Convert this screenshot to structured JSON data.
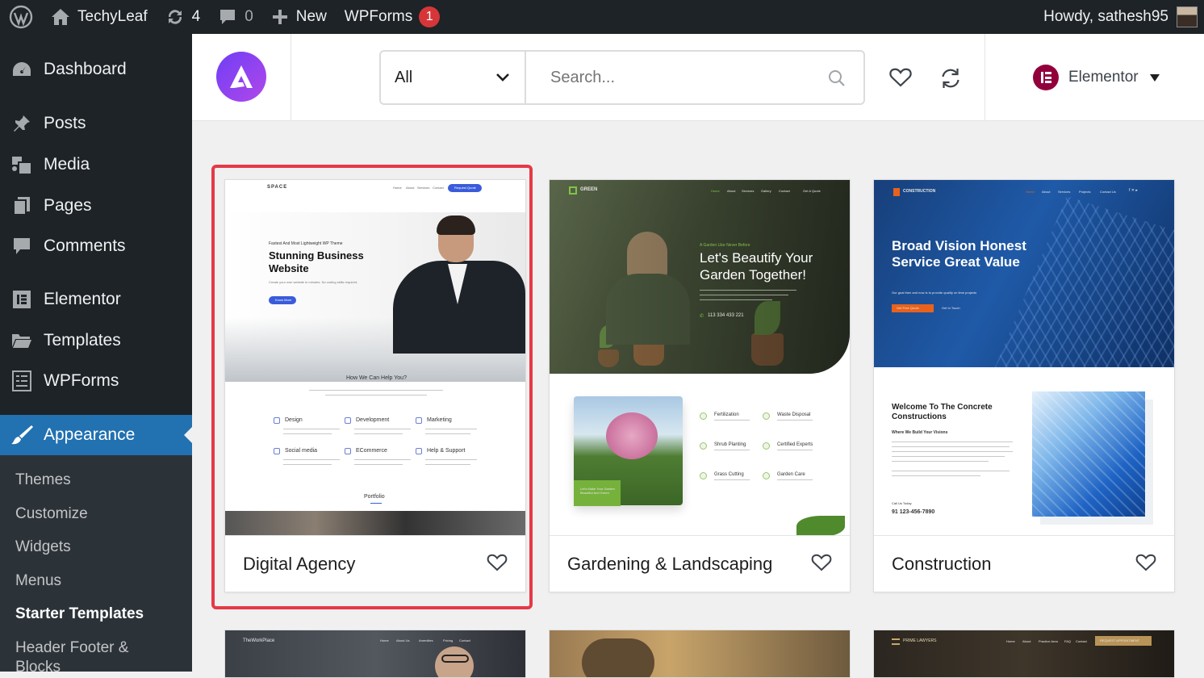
{
  "adminbar": {
    "site_name": "TechyLeaf",
    "updates_count": "4",
    "comments_count": "0",
    "new_label": "New",
    "wpforms_label": "WPForms",
    "wpforms_badge": "1",
    "howdy": "Howdy, sathesh95"
  },
  "sidebar": {
    "items": [
      {
        "label": "Dashboard",
        "icon": "dashboard-icon"
      },
      {
        "label": "Posts",
        "icon": "pin-icon"
      },
      {
        "label": "Media",
        "icon": "media-icon"
      },
      {
        "label": "Pages",
        "icon": "pages-icon"
      },
      {
        "label": "Comments",
        "icon": "comment-icon"
      },
      {
        "label": "Elementor",
        "icon": "elementor-icon"
      },
      {
        "label": "Templates",
        "icon": "folder-icon"
      },
      {
        "label": "WPForms",
        "icon": "form-icon"
      },
      {
        "label": "Appearance",
        "icon": "brush-icon"
      }
    ],
    "submenu": [
      "Themes",
      "Customize",
      "Widgets",
      "Menus",
      "Starter Templates",
      "Header Footer &",
      "Blocks"
    ]
  },
  "header": {
    "filter_value": "All",
    "search_placeholder": "Search...",
    "builder_label": "Elementor"
  },
  "cards": [
    {
      "title": "Digital Agency",
      "preview": {
        "brand": "SPACE",
        "nav": [
          "Home",
          "About",
          "Services",
          "Contact"
        ],
        "cta": "Request Quote",
        "kicker": "Fastest And Most Lightweight WP Theme",
        "heading": "Stunning Business Website",
        "sub": "Create your own website in minutes. No coding skills required.",
        "button": "Know More",
        "section_title": "How We Can Help You?",
        "features": [
          "Design",
          "Development",
          "Marketing",
          "Social media",
          "ECommerce",
          "Help & Support"
        ],
        "portfolio": "Portfolio"
      }
    },
    {
      "title": "Gardening & Landscaping",
      "preview": {
        "brand": "GREEN",
        "nav": [
          "Home",
          "About",
          "Services",
          "Gallery",
          "Contact"
        ],
        "cta": "Get A Quote",
        "kicker": "A Garden Like Never Before",
        "heading": "Let's Beautify Your Garden Together!",
        "phone": "113 334 433 221",
        "tag": "Let's Make Your Garden Beautiful And Green",
        "features": [
          "Fertilization",
          "Waste Disposal",
          "Shrub Planting",
          "Certified Experts",
          "Grass Cutting",
          "Garden Care"
        ]
      }
    },
    {
      "title": "Construction",
      "preview": {
        "brand": "CONSTRUCTION",
        "nav": [
          "Home",
          "About",
          "Services",
          "Projects",
          "Contact Us"
        ],
        "heading": "Broad Vision Honest Service Great Value",
        "sub": "Our goal then and now is to provide quality on time projects",
        "btn1": "Get Free Quote",
        "btn2": "Get In Touch",
        "welcome": "Welcome To The Concrete Constructions",
        "subhead": "Where We Build Your Visions",
        "call_label": "Call Us Today",
        "phone": "91 123-456-7890"
      }
    }
  ],
  "row2": [
    {
      "brand": "TheWorkPlace",
      "nav": [
        "Home",
        "About Us",
        "Amenities",
        "Pricing",
        "Contact"
      ]
    },
    {
      "brand": ""
    },
    {
      "brand": "PRIME LAWYERS",
      "nav": [
        "Home",
        "About",
        "Practice Area",
        "FAQ",
        "Contact"
      ],
      "cta": "REQUEST APPOINTMENT"
    }
  ],
  "colors": {
    "admin_bg": "#1d2327",
    "accent": "#2271b1",
    "highlight": "#e63946",
    "astra_gradient_start": "#6f3ff5",
    "astra_gradient_end": "#b147ea",
    "elementor": "#92003b"
  }
}
